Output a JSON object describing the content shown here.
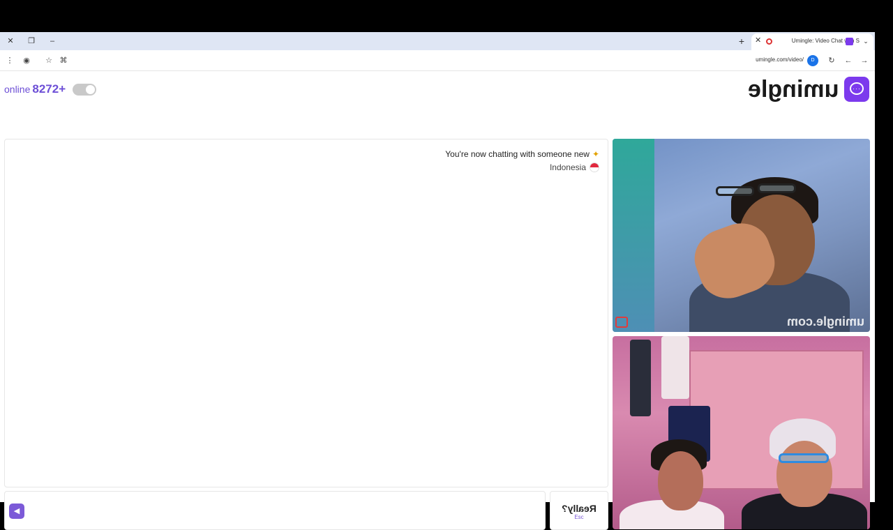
{
  "browser": {
    "tab_title": "Umingle: Video Chat with S",
    "url": "umingle.com/video/",
    "new_tab_label": "+",
    "site_badge": "D"
  },
  "header": {
    "online_count": "8272+",
    "online_label": "online",
    "logo_text": "umingle"
  },
  "chat": {
    "status_message": "You're now chatting with someone new",
    "country": "Indonesia"
  },
  "input": {
    "placeholder": "",
    "send_icon": "send-arrow-icon"
  },
  "esc_button": {
    "label": "Really?",
    "hint": "Esc"
  },
  "video": {
    "watermark": "umingle.com"
  },
  "colors": {
    "brand": "#7c3aed",
    "accent": "#6d4fd6"
  }
}
